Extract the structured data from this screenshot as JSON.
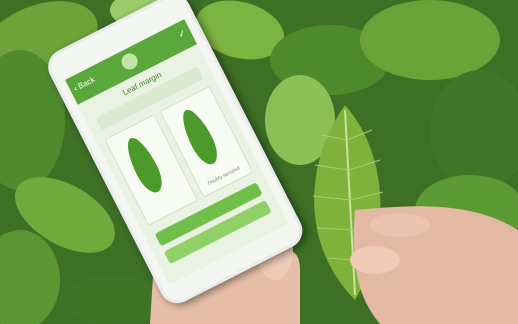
{
  "scene": {
    "colors": {
      "foliage_dark": "#2e5a1e",
      "foliage_mid": "#4f8a2e",
      "foliage_light": "#8cc056",
      "leaf_bright": "#7fb23a",
      "skin": "#e9c2ad",
      "app_green": "#5aa83c"
    }
  },
  "app": {
    "back_label": "Back",
    "screen_title": "Leaf margin",
    "instruction": "",
    "option_1": "",
    "option_2": "Doubly serrated",
    "button_1": "",
    "button_2": "",
    "icons": [
      "logo-icon",
      "check-icon",
      "back-arrow-icon"
    ]
  }
}
